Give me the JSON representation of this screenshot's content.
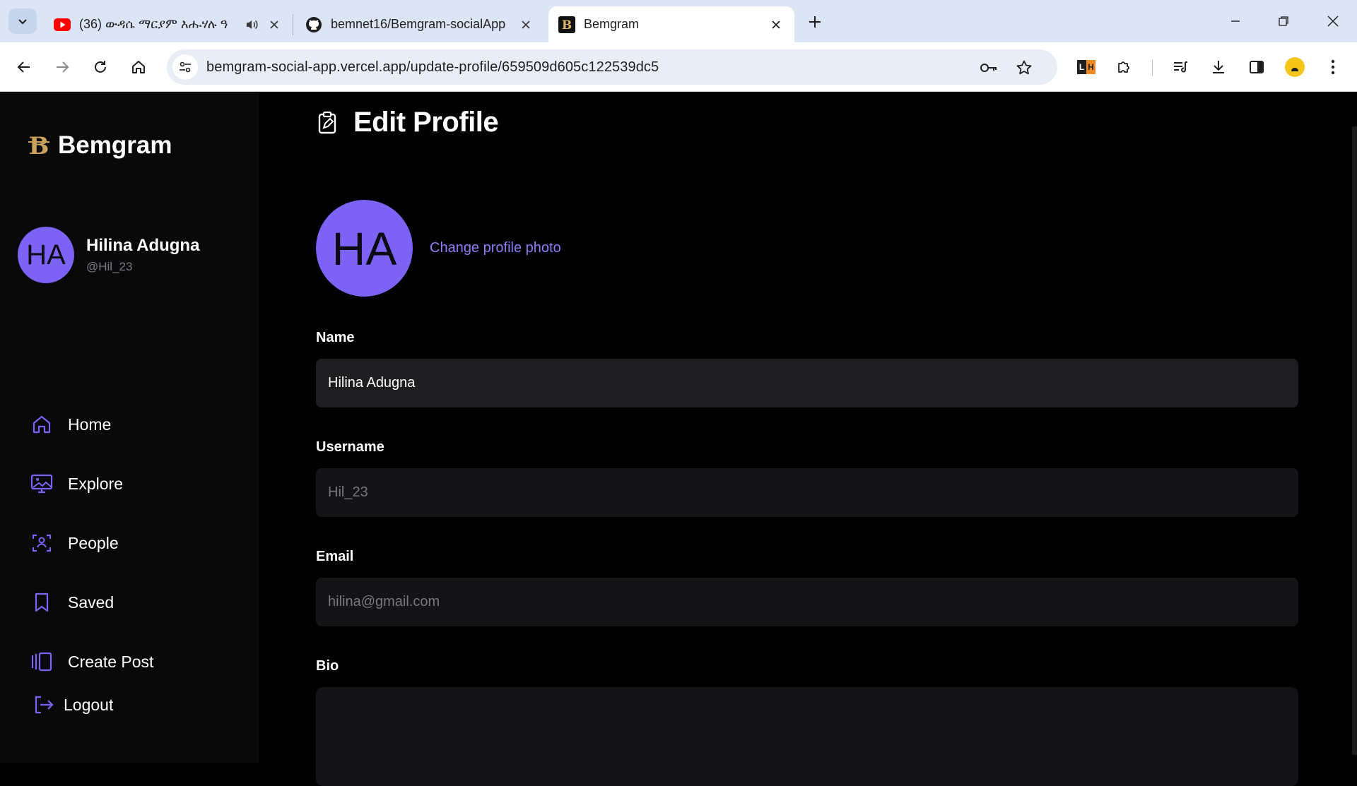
{
  "browser": {
    "tabs": [
      {
        "title": "(36) ውዳሴ ማርያም እሑሃሉ ዓ",
        "favicon": "youtube-icon"
      },
      {
        "title": "bemnet16/Bemgram-socialApp",
        "favicon": "github-icon"
      },
      {
        "title": "Bemgram",
        "favicon": "bemgram-icon"
      }
    ],
    "active_tab": 2,
    "url": "bemgram-social-app.vercel.app/update-profile/659509d605c122539dc5"
  },
  "sidebar": {
    "brand": "Bemgram",
    "user": {
      "initials": "HA",
      "name": "Hilina Adugna",
      "handle": "@Hil_23"
    },
    "nav": [
      {
        "label": "Home",
        "icon": "home-icon"
      },
      {
        "label": "Explore",
        "icon": "explore-icon"
      },
      {
        "label": "People",
        "icon": "people-icon"
      },
      {
        "label": "Saved",
        "icon": "bookmark-icon"
      },
      {
        "label": "Create Post",
        "icon": "gallery-icon"
      }
    ],
    "logout": "Logout"
  },
  "main": {
    "title": "Edit Profile",
    "avatar_initials": "HA",
    "change_photo": "Change profile photo",
    "fields": {
      "name": {
        "label": "Name",
        "value": "Hilina Adugna"
      },
      "username": {
        "label": "Username",
        "value": "Hil_23"
      },
      "email": {
        "label": "Email",
        "value": "hilina@gmail.com"
      },
      "bio": {
        "label": "Bio",
        "value": ""
      }
    }
  },
  "colors": {
    "accent": "#7d63f5",
    "link": "#8f7cf8",
    "sidebar_bg": "#09090a",
    "input_bg": "#1e1e21"
  }
}
